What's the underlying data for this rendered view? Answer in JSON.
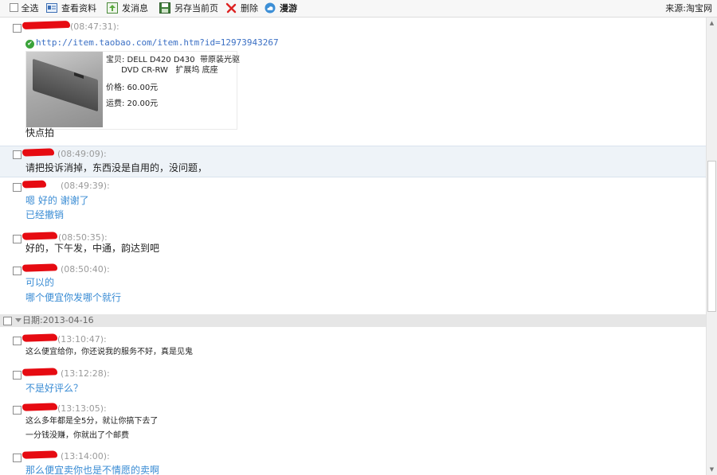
{
  "toolbar": {
    "select_all": "全选",
    "view_profile": "查看资料",
    "send_message": "发消息",
    "save_page": "另存当前页",
    "delete": "删除",
    "roam": "漫游",
    "source": "来源:淘宝网"
  },
  "messages": [
    {
      "time": "(08:47:31):",
      "link": "http://item.taobao.com/item.htm?id=12973943267",
      "product": {
        "title_line1": "宝贝: DELL D420 D430  带原装光驱",
        "title_line2": "      DVD CR-RW   扩展坞 底座",
        "price": "价格: 60.00元",
        "shipping": "运费: 20.00元"
      },
      "lines": [
        "快点拍"
      ]
    },
    {
      "time": "(08:49:09):",
      "lines": [
        "请把投诉消掉，东西没是自用的，没问题，"
      ]
    },
    {
      "time": "(08:49:39):",
      "lines": [
        "嗯 好的 谢谢了",
        "已经撤销"
      ]
    },
    {
      "time": "(08:50:35):",
      "lines": [
        "好的，下午发，中通，韵达到吧"
      ]
    },
    {
      "time": "(08:50:40):",
      "lines": [
        "可以的",
        "哪个便宜你发哪个就行"
      ]
    }
  ],
  "date_separator": "日期:2013-04-16",
  "messages2": [
    {
      "time": "(13:10:47):",
      "lines": [
        "这么便宜给你，你还说我的服务不好，真是见鬼"
      ]
    },
    {
      "time": "(13:12:28):",
      "lines": [
        "不是好评么？"
      ]
    },
    {
      "time": "(13:13:05):",
      "lines": [
        "这么多年都是全5分，就让你搞下去了",
        "一分钱没赚，你就出了个邮费"
      ]
    },
    {
      "time": "(13:14:00):",
      "lines": [
        "那么便宜卖你也是不情愿的卖啊"
      ]
    }
  ],
  "scrollbar": {
    "up": "▲",
    "down": "▼"
  }
}
